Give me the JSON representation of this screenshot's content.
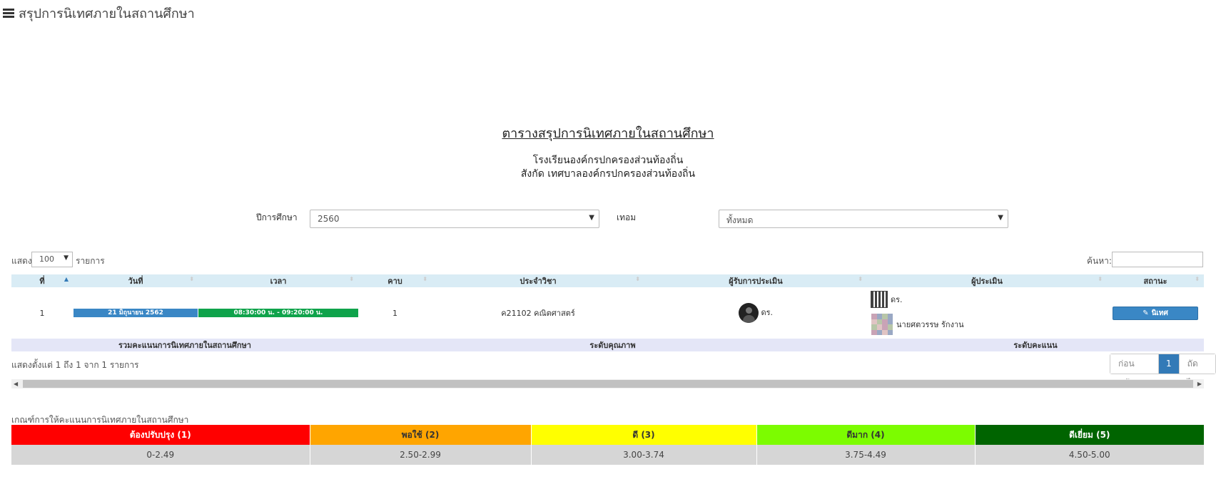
{
  "header": {
    "title": "สรุปการนิเทศภายในสถานศึกษา"
  },
  "report": {
    "title": "ตารางสรุปการนิเทศภายในสถานศึกษา",
    "school": "โรงเรียนองค์กรปกครองส่วนท้องถิ่น",
    "affiliation": "สังกัด เทศบาลองค์กรปกครองส่วนท้องถิ่น"
  },
  "filters": {
    "year_label": "ปีการศึกษา",
    "year_value": "2560",
    "term_label": "เทอม",
    "term_value": "ทั้งหมด"
  },
  "table_controls": {
    "show_label": "แสดง",
    "page_length": "100",
    "items_label": "รายการ",
    "search_label": "ค้นหา:"
  },
  "table": {
    "columns": [
      "ที่",
      "วันที่",
      "เวลา",
      "คาบ",
      "ประจำวิชา",
      "ผู้รับการประเมิน",
      "ผู้ประเมิน",
      "สถานะ"
    ],
    "rows": [
      {
        "no": "1",
        "date": "21 มิถุนายน 2562",
        "time": "08:30:00 น. - 09:20:00 น.",
        "period": "1",
        "subject": "ค21102 คณิตศาสตร์",
        "evaluatee": "ดร.",
        "evaluator_1": "ดร.",
        "evaluator_2": "นายศตวรรษ รักงาน",
        "action_label": "นิเทศ"
      }
    ],
    "summary": {
      "total_label": "รวมคะแนนการนิเทศภายในสถานศึกษา",
      "quality_label": "ระดับคุณภาพ",
      "score_label": "ระดับคะแนน"
    }
  },
  "footer": {
    "info": "แสดงตั้งแต่ 1 ถึง 1 จาก 1 รายการ",
    "prev": "ก่อนหน้า",
    "current_page": "1",
    "next": "ถัดไป"
  },
  "criteria": {
    "label": "เกณฑ์การให้คะแนนการนิเทศภายในสถานศึกษา",
    "levels": [
      {
        "name": "ต้องปรับปรุง (1)",
        "range": "0-2.49",
        "color": "#ff0000",
        "text_color": "#ffffff"
      },
      {
        "name": "พอใช้ (2)",
        "range": "2.50-2.99",
        "color": "#ffa500",
        "text_color": "#333333"
      },
      {
        "name": "ดี (3)",
        "range": "3.00-3.74",
        "color": "#ffff00",
        "text_color": "#333333"
      },
      {
        "name": "ดีมาก (4)",
        "range": "3.75-4.49",
        "color": "#7cfc00",
        "text_color": "#333333"
      },
      {
        "name": "ดีเยี่ยม (5)",
        "range": "4.50-5.00",
        "color": "#006400",
        "text_color": "#ffffff"
      }
    ]
  }
}
